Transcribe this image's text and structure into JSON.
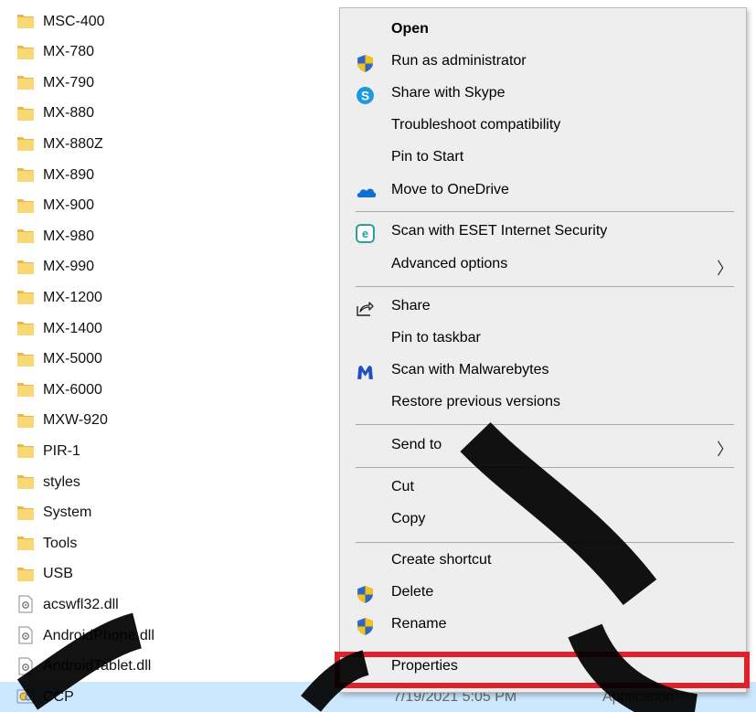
{
  "files": [
    {
      "name": "MSC-400",
      "icon": "folder-icon"
    },
    {
      "name": "MX-780",
      "icon": "folder-icon"
    },
    {
      "name": "MX-790",
      "icon": "folder-icon"
    },
    {
      "name": "MX-880",
      "icon": "folder-icon"
    },
    {
      "name": "MX-880Z",
      "icon": "folder-icon"
    },
    {
      "name": "MX-890",
      "icon": "folder-icon"
    },
    {
      "name": "MX-900",
      "icon": "folder-icon"
    },
    {
      "name": "MX-980",
      "icon": "folder-icon"
    },
    {
      "name": "MX-990",
      "icon": "folder-icon"
    },
    {
      "name": "MX-1200",
      "icon": "folder-icon"
    },
    {
      "name": "MX-1400",
      "icon": "folder-icon"
    },
    {
      "name": "MX-5000",
      "icon": "folder-icon"
    },
    {
      "name": "MX-6000",
      "icon": "folder-icon"
    },
    {
      "name": "MXW-920",
      "icon": "folder-icon"
    },
    {
      "name": "PIR-1",
      "icon": "folder-icon"
    },
    {
      "name": "styles",
      "icon": "folder-icon"
    },
    {
      "name": "System",
      "icon": "folder-icon"
    },
    {
      "name": "Tools",
      "icon": "folder-icon"
    },
    {
      "name": "USB",
      "icon": "folder-icon"
    },
    {
      "name": "acswfl32.dll",
      "icon": "dll-file-icon"
    },
    {
      "name": "AndroidPhone.dll",
      "icon": "dll-file-icon"
    },
    {
      "name": "AndroidTablet.dll",
      "icon": "dll-file-icon"
    },
    {
      "name": "CCP",
      "icon": "application-icon",
      "date": "7/19/2021 5:05 PM",
      "type": "Application",
      "selected": true
    }
  ],
  "context_menu": {
    "items": [
      {
        "label": "Open",
        "bold": true
      },
      {
        "label": "Run as administrator",
        "icon": "uac-shield-icon"
      },
      {
        "label": "Share with Skype",
        "icon": "skype-icon"
      },
      {
        "label": "Troubleshoot compatibility"
      },
      {
        "label": "Pin to Start"
      },
      {
        "label": "Move to OneDrive",
        "icon": "onedrive-icon"
      },
      {
        "label": "Scan with ESET Internet Security",
        "icon": "eset-icon"
      },
      {
        "label": "Advanced options",
        "submenu": true
      },
      {
        "label": "Share",
        "icon": "share-icon"
      },
      {
        "label": "Pin to taskbar"
      },
      {
        "label": "Scan with Malwarebytes",
        "icon": "malwarebytes-icon"
      },
      {
        "label": "Restore previous versions"
      },
      {
        "label": "Send to",
        "submenu": true
      },
      {
        "label": "Cut"
      },
      {
        "label": "Copy"
      },
      {
        "label": "Create shortcut"
      },
      {
        "label": "Delete",
        "icon": "uac-shield-icon"
      },
      {
        "label": "Rename",
        "icon": "uac-shield-icon"
      },
      {
        "label": "Properties"
      }
    ],
    "submenu_arrow": "〉"
  },
  "colors": {
    "selection": "#cce8ff",
    "menu_bg": "#eeeeee",
    "highlight_border": "#e0202a",
    "folder": "#f8d775"
  }
}
